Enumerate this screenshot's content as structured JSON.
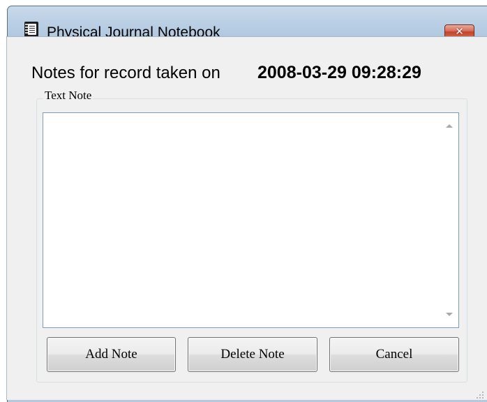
{
  "window": {
    "title": "Physical Journal Notebook",
    "close_glyph": "✕",
    "icon": "notebook-icon"
  },
  "main": {
    "heading": "Notes for record taken on",
    "timestamp": "2008-03-29 09:28:29"
  },
  "text_note": {
    "label": "Text Note",
    "value": ""
  },
  "buttons": {
    "add": "Add Note",
    "delete": "Delete Note",
    "cancel": "Cancel"
  },
  "colors": {
    "title_bar": "#b7cde3",
    "close_button": "#c5432b",
    "dialog_background": "#f0f0f0"
  }
}
